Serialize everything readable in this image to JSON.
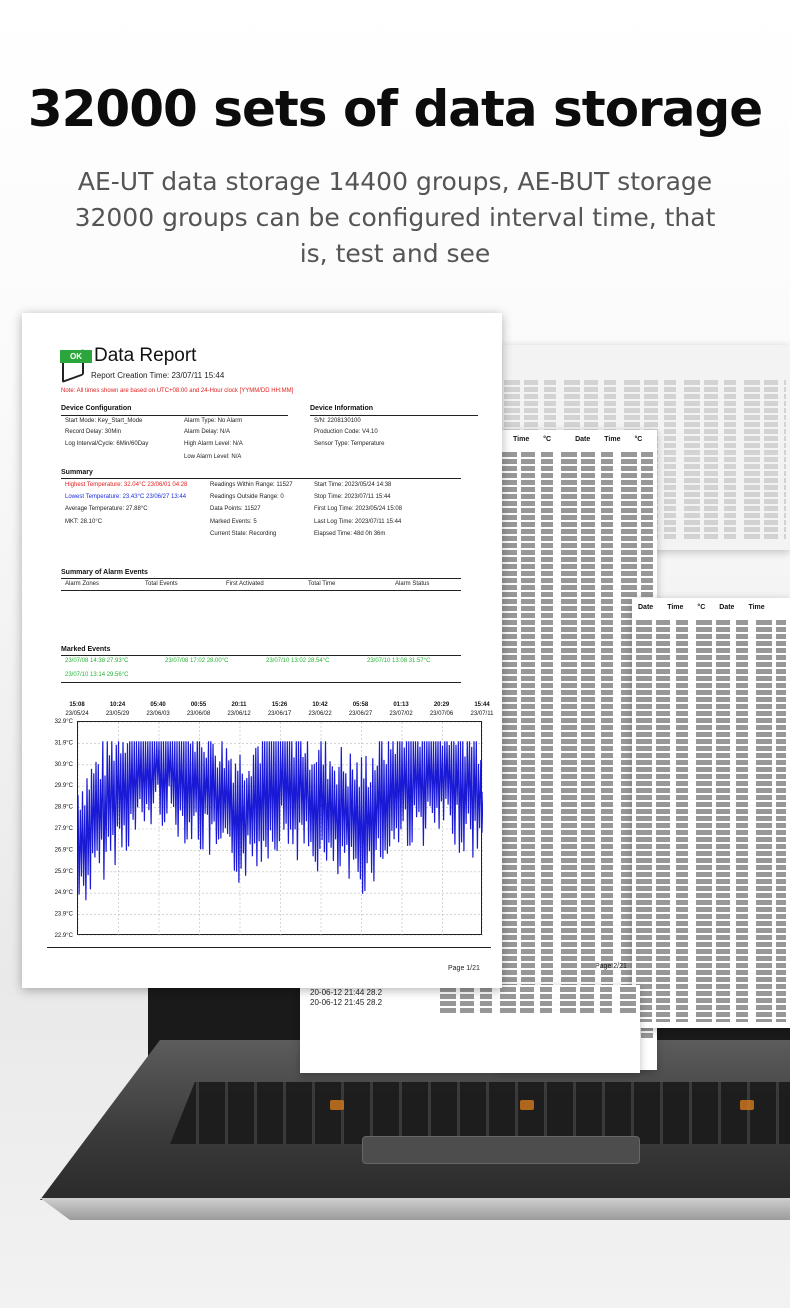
{
  "hero": {
    "title": "32000 sets of data storage",
    "subtitle": "AE-UT data storage 14400 groups, AE-BUT storage 32000 groups can be configured interval time, that is, test and see"
  },
  "report": {
    "logo_badge": "OK",
    "title": "Data Report",
    "created": "Report Creation Time: 23/07/11 15:44",
    "note": "Note: All times shown are based on UTC+08:00 and 24-Hour clock [YYMM/DD HH:MM]",
    "device_config": {
      "heading": "Device Configuration",
      "start_mode": "Start Mode: Key_Start_Mode",
      "record_delay": "Record Delay: 30Min",
      "log_interval": "Log Interval/Cycle: 6Min/60Day",
      "alarm_type": "Alarm Type: No Alarm",
      "alarm_delay": "Alarm Delay: N/A",
      "high_alarm": "High Alarm Level: N/A",
      "low_alarm": "Low Alarm Level: N/A"
    },
    "device_info": {
      "heading": "Device Information",
      "sn": "S/N: 2208130100",
      "production_code": "Production Code: V4.10",
      "sensor_type": "Sensor Type: Temperature"
    },
    "summary": {
      "heading": "Summary",
      "highest": "Highest Temperature: 32.04°C  23/06/01 04:28",
      "lowest": "Lowest Temperature: 23.43°C  23/06/27 13:44",
      "average": "Average Temperature: 27.88°C",
      "mkt": "MKT: 28.10°C",
      "within": "Readings Within Range: 11527",
      "outside": "Readings Outside Range: 0",
      "points": "Data Points: 11527",
      "marked": "Marked Events: 5",
      "state": "Current State: Recording",
      "start": "Start Time: 2023/05/24 14:38",
      "stop": "Stop Time: 2023/07/11 15:44",
      "first_log": "First Log Time: 2023/05/24 15:08",
      "last_log": "Last Log Time: 2023/07/11 15:44",
      "elapsed": "Elapsed Time: 48d 0h 36m"
    },
    "alarm_events": {
      "heading": "Summary of Alarm Events",
      "cols": [
        "Alarm Zones",
        "Total Events",
        "First Activated",
        "Total Time",
        "Alarm Status"
      ]
    },
    "marked_events": {
      "heading": "Marked Events",
      "items": [
        "23/07/08 14:38  27.93°C",
        "23/07/08 17:02  28.00°C",
        "23/07/10 13:02  28.54°C",
        "23/07/10 13:08  31.57°C",
        "23/07/10 13:14  29.56°C"
      ]
    },
    "chart_labels": {
      "x_times": [
        "15:08",
        "10:24",
        "05:40",
        "00:55",
        "20:11",
        "15:26",
        "10:42",
        "05:58",
        "01:13",
        "20:29",
        "15:44"
      ],
      "x_dates": [
        "23/05/24",
        "23/05/29",
        "23/06/03",
        "23/06/08",
        "23/06/12",
        "23/06/17",
        "23/06/22",
        "23/06/27",
        "23/07/02",
        "23/07/06",
        "23/07/11"
      ],
      "y_ticks": [
        "32.9°C",
        "31.9°C",
        "30.9°C",
        "29.9°C",
        "28.9°C",
        "27.9°C",
        "26.9°C",
        "25.9°C",
        "24.9°C",
        "23.9°C",
        "22.9°C"
      ]
    },
    "page": "Page 1/21"
  },
  "back_sheets": {
    "col_time": "Time",
    "col_temp": "°C",
    "col_date": "Date",
    "page_mid": "Page 2/21",
    "strip_rows": [
      "20-06-12   21:44      28.2",
      "20-06-12   21:45      28.2"
    ]
  },
  "chart_data": {
    "type": "line",
    "title": "",
    "xlabel": "",
    "ylabel": "",
    "ylim": [
      22.9,
      32.9
    ],
    "x": [
      "23/05/24 15:08",
      "23/05/29 10:24",
      "23/06/03 05:40",
      "23/06/08 00:55",
      "23/06/12 20:11",
      "23/06/17 15:26",
      "23/06/22 10:42",
      "23/06/27 05:58",
      "23/07/02 01:13",
      "23/07/06 20:29",
      "23/07/11 15:44"
    ],
    "series": [
      {
        "values": [
          27.2,
          29.8,
          31.5,
          30.1,
          28.6,
          30.4,
          29.0,
          28.1,
          30.3,
          30.6,
          29.6
        ]
      }
    ],
    "grid": true,
    "line_color": "#1a1ad6"
  }
}
